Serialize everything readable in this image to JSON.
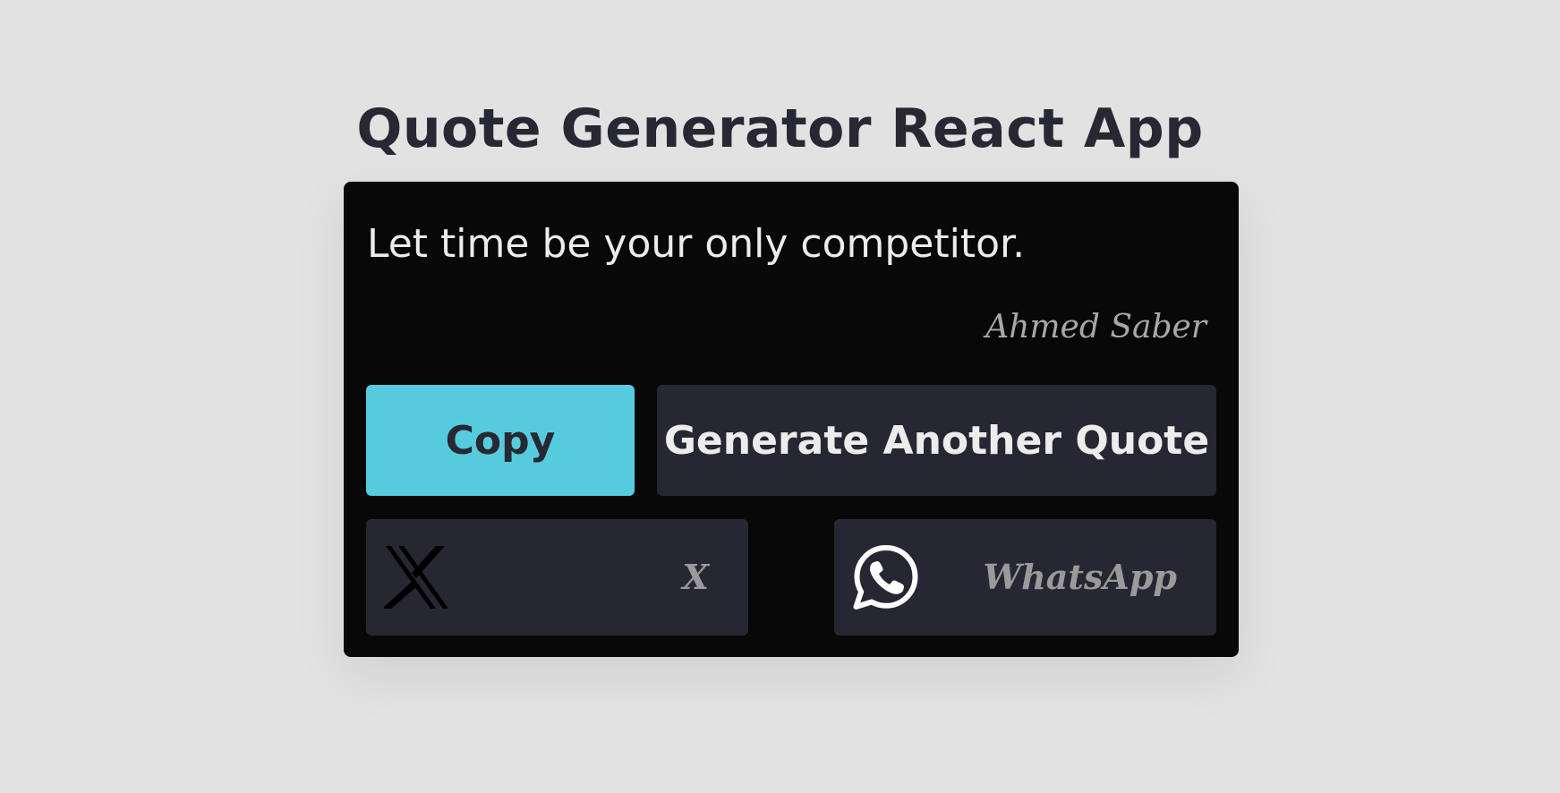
{
  "app": {
    "title": "Quote Generator React App"
  },
  "quote": {
    "text": "Let time be your only competitor.",
    "author": "Ahmed Saber"
  },
  "actions": {
    "copy_label": "Copy",
    "generate_label": "Generate Another Quote"
  },
  "share": {
    "x": {
      "label": "X",
      "icon": "x-logo-icon"
    },
    "whatsapp": {
      "label": "WhatsApp",
      "icon": "whatsapp-icon"
    }
  },
  "colors": {
    "page_background": "#e2e2e2",
    "card_background": "#080808",
    "accent": "#57cbde",
    "button_dark": "#262733",
    "title_text": "#272833",
    "quote_text": "#ececec",
    "muted_text": "#a8a8a8"
  }
}
